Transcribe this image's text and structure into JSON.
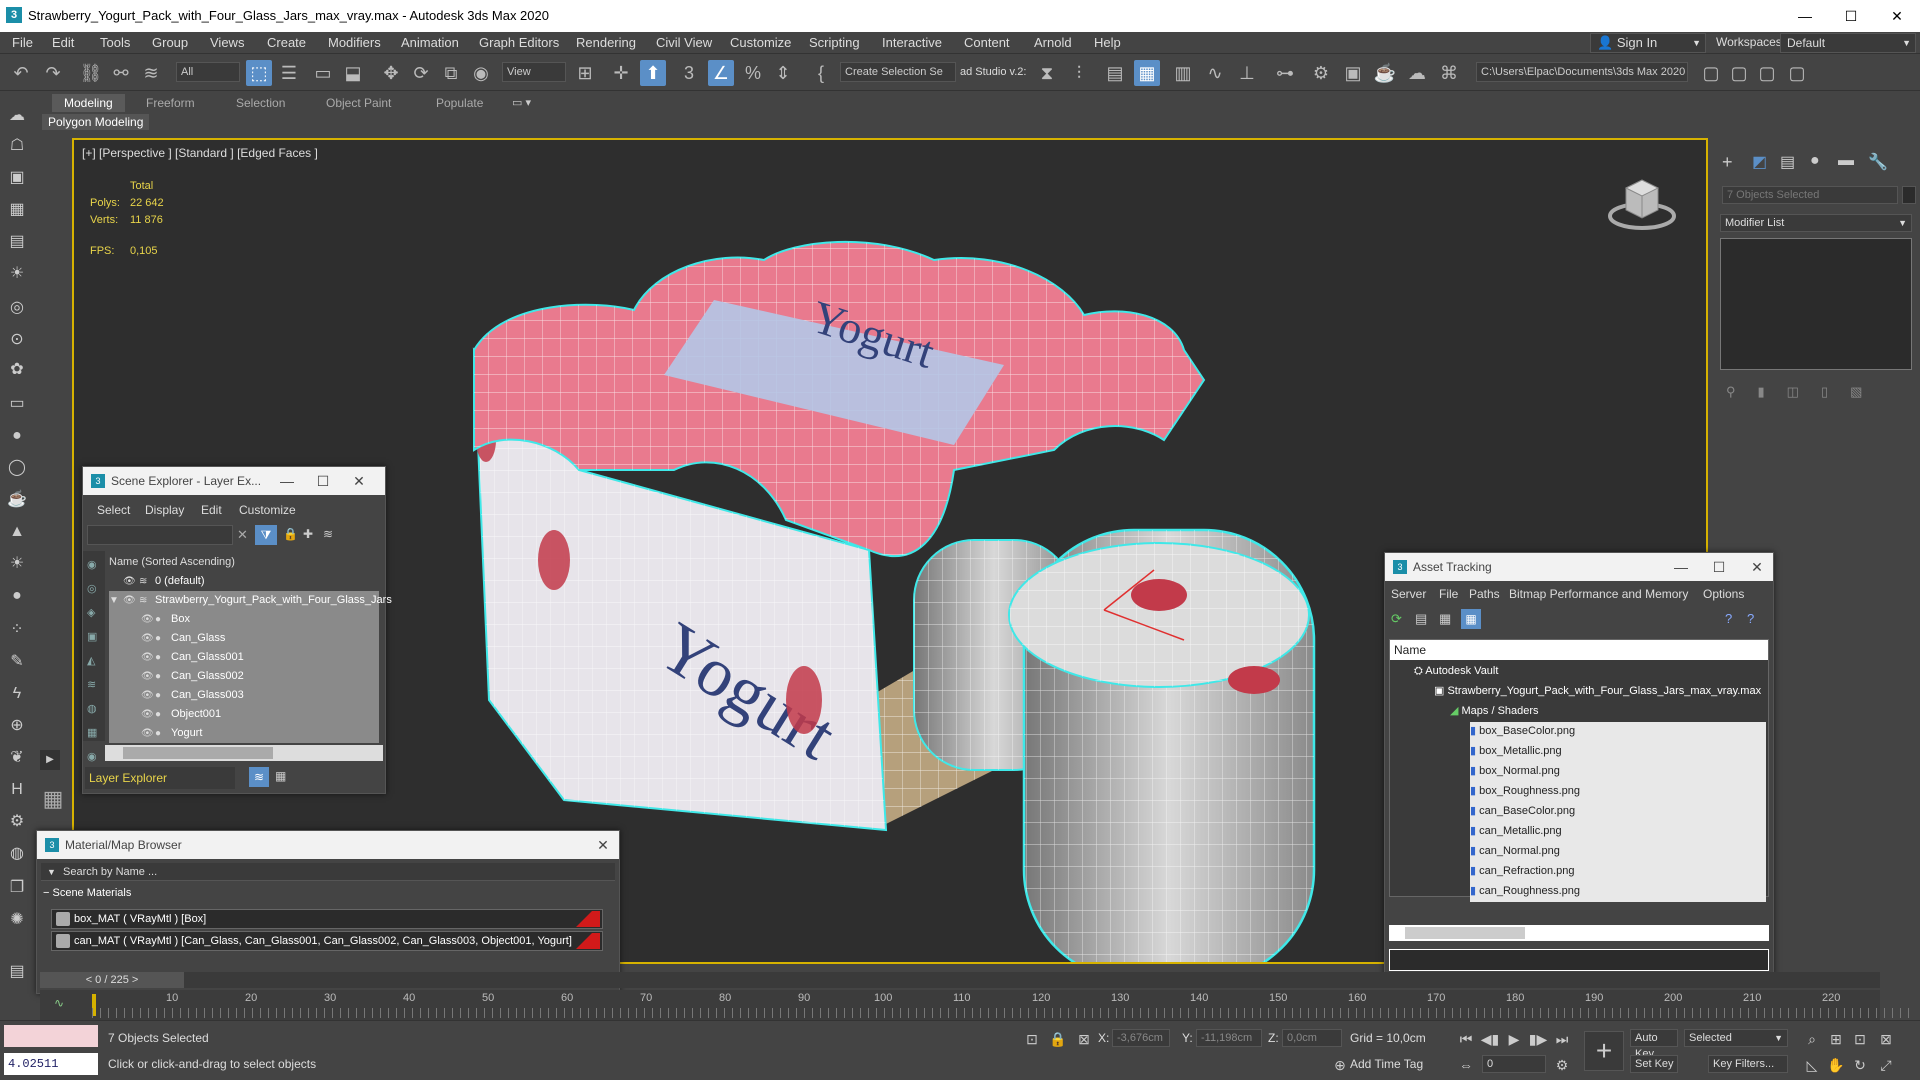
{
  "window": {
    "title": "Strawberry_Yogurt_Pack_with_Four_Glass_Jars_max_vray.max - Autodesk 3ds Max 2020",
    "min": "—",
    "max": "☐",
    "close": "✕"
  },
  "menubar": {
    "items": [
      "File",
      "Edit",
      "Tools",
      "Group",
      "Views",
      "Create",
      "Modifiers",
      "Animation",
      "Graph Editors",
      "Rendering",
      "Civil View",
      "Customize",
      "Scripting",
      "Interactive",
      "Content",
      "Arnold",
      "Help"
    ],
    "signin": "Sign In",
    "workspaces_label": "Workspaces:",
    "workspaces_value": "Default"
  },
  "toolbar": {
    "filter": "All",
    "view": "View",
    "selection_set": "Create Selection Se",
    "studio": "ad Studio v.2:",
    "project_path": "C:\\Users\\Elpac\\Documents\\3ds Max 2020"
  },
  "ribbon": {
    "tabs": [
      "Modeling",
      "Freeform",
      "Selection",
      "Object Paint",
      "Populate"
    ],
    "active": "Modeling",
    "sub": "Polygon Modeling"
  },
  "viewport": {
    "label": "[+] [Perspective ] [Standard ] [Edged Faces ]",
    "stats_total": "Total",
    "polys_label": "Polys:",
    "polys_value": "22 642",
    "verts_label": "Verts:",
    "verts_value": "11 876",
    "fps_label": "FPS:",
    "fps_value": "0,105",
    "box_text": "Yogurt",
    "lid_text": "Yogurt"
  },
  "command_panel": {
    "object_sel": "7 Objects Selected",
    "modifier_list": "Modifier List"
  },
  "scene_explorer": {
    "title": "Scene Explorer - Layer Ex...",
    "menus": [
      "Select",
      "Display",
      "Edit",
      "Customize"
    ],
    "column": "Name (Sorted Ascending)",
    "rows": [
      {
        "label": "0 (default)",
        "indent": 0
      },
      {
        "label": "Strawberry_Yogurt_Pack_with_Four_Glass_Jars",
        "indent": 1
      },
      {
        "label": "Box",
        "indent": 2
      },
      {
        "label": "Can_Glass",
        "indent": 2
      },
      {
        "label": "Can_Glass001",
        "indent": 2
      },
      {
        "label": "Can_Glass002",
        "indent": 2
      },
      {
        "label": "Can_Glass003",
        "indent": 2
      },
      {
        "label": "Object001",
        "indent": 2
      },
      {
        "label": "Yogurt",
        "indent": 2
      }
    ],
    "footer": "Layer Explorer"
  },
  "material_browser": {
    "title": "Material/Map Browser",
    "search": "Search by Name ...",
    "group": "Scene Materials",
    "items": [
      "box_MAT ( VRayMtl ) [Box]",
      "can_MAT ( VRayMtl ) [Can_Glass, Can_Glass001, Can_Glass002, Can_Glass003, Object001, Yogurt]"
    ]
  },
  "asset_tracking": {
    "title": "Asset Tracking",
    "menus": [
      "Server",
      "File",
      "Paths",
      "Bitmap Performance and Memory",
      "Options"
    ],
    "column": "Name",
    "vault": "Autodesk Vault",
    "file": "Strawberry_Yogurt_Pack_with_Four_Glass_Jars_max_vray.max",
    "maps": "Maps / Shaders",
    "textures": [
      "box_BaseColor.png",
      "box_Metallic.png",
      "box_Normal.png",
      "box_Roughness.png",
      "can_BaseColor.png",
      "can_Metallic.png",
      "can_Normal.png",
      "can_Refraction.png",
      "can_Roughness.png"
    ]
  },
  "timeline": {
    "frame": "0 / 225",
    "ticks": [
      "10",
      "20",
      "30",
      "40",
      "50",
      "60",
      "70",
      "80",
      "90",
      "100",
      "110",
      "120",
      "130",
      "140",
      "150",
      "160",
      "170",
      "180",
      "190",
      "200",
      "210",
      "220"
    ]
  },
  "status": {
    "maxscript": "4.02511",
    "objects": "7 Objects Selected",
    "prompt": "Click or click-and-drag to select objects",
    "x_label": "X:",
    "x": "-3,676cm",
    "y_label": "Y:",
    "y": "-11,198cm",
    "z_label": "Z:",
    "z": "0,0cm",
    "grid": "Grid = 10,0cm",
    "add_time_tag": "Add Time Tag",
    "auto_key": "Auto Key",
    "selected": "Selected",
    "set_key": "Set Key",
    "key_filters": "Key Filters...",
    "frame_value": "0"
  }
}
